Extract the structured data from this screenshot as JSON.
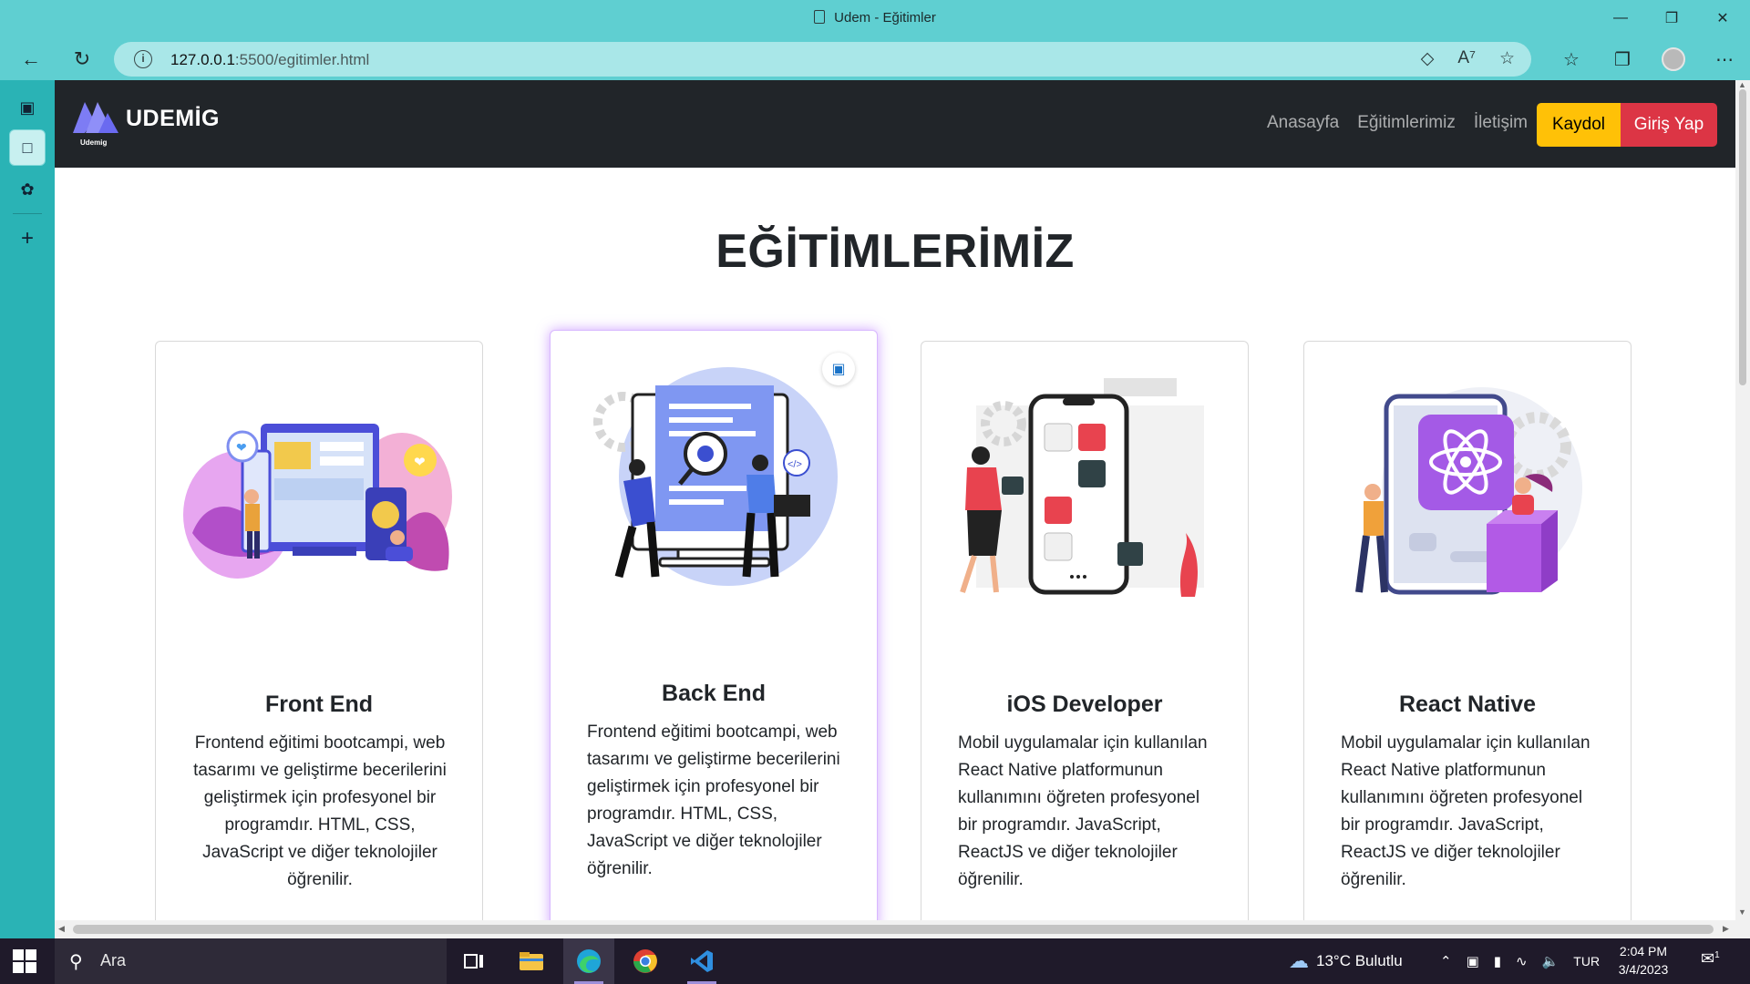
{
  "browser": {
    "tab_title": "Udem - Eğitimler",
    "url_host": "127.0.0.1",
    "url_path": ":5500/egitimler.html",
    "info_icon": "i"
  },
  "site": {
    "brand_name": "UDEMİG",
    "brand_small": "Udemig",
    "nav": [
      "Anasayfa",
      "Eğitimlerimiz",
      "İletişim"
    ],
    "signup_label": "Kaydol",
    "login_label": "Giriş Yap",
    "heading": "EĞİTİMLERİMİZ",
    "colors": {
      "navbar": "#212529",
      "signup": "#ffc107",
      "login": "#dc3545",
      "hover_glow": "#aa5aff"
    }
  },
  "cards": [
    {
      "title": "Front End",
      "text": "Frontend eğitimi bootcampi, web tasarımı ve geliştirme becerilerini geliştirmek için profesyonel bir programdır. HTML, CSS, JavaScript ve diğer teknolojiler öğrenilir."
    },
    {
      "title": "Back End",
      "text": "Frontend eğitimi bootcampi, web tasarımı ve geliştirme becerilerini geliştirmek için profesyonel bir programdır. HTML, CSS, JavaScript ve diğer teknolojiler öğrenilir."
    },
    {
      "title": "iOS Developer",
      "text": "Mobil uygulamalar için kullanılan React Native platformunun kullanımını öğreten profesyonel bir programdır. JavaScript, ReactJS ve diğer teknolojiler öğrenilir."
    },
    {
      "title": "React Native",
      "text": "Mobil uygulamalar için kullanılan React Native platformunun kullanımını öğreten profesyonel bir programdır. JavaScript, ReactJS ve diğer teknolojiler öğrenilir."
    }
  ],
  "taskbar": {
    "search_placeholder": "Ara",
    "weather": "13°C  Bulutlu",
    "language": "TUR",
    "time": "2:04 PM",
    "date": "3/4/2023",
    "notification_count": "1"
  }
}
